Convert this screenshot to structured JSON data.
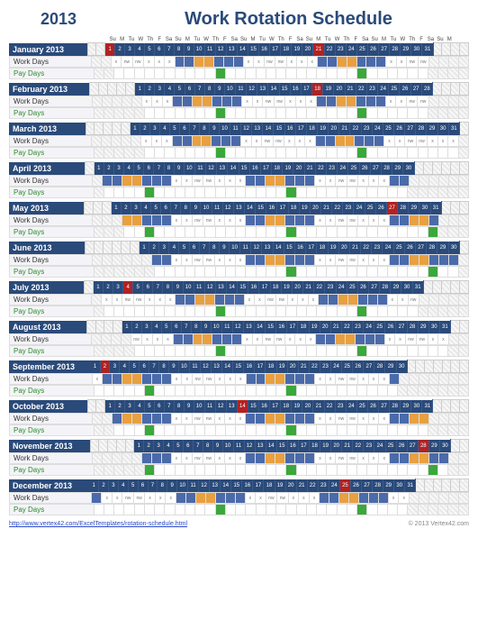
{
  "year": "2013",
  "title": "Work Rotation Schedule",
  "dayHeaders": [
    "Su",
    "M",
    "Tu",
    "W",
    "Th",
    "F",
    "Sa",
    "Su",
    "M",
    "Tu",
    "W",
    "Th",
    "F",
    "Sa",
    "Su",
    "M",
    "Tu",
    "W",
    "Th",
    "F",
    "Sa",
    "Su",
    "M",
    "Tu",
    "W",
    "Th",
    "F",
    "Sa",
    "Su",
    "M",
    "Tu",
    "W",
    "Th",
    "F",
    "Sa",
    "Su",
    "M"
  ],
  "rowLabels": {
    "work": "Work Days",
    "pay": "Pay Days"
  },
  "months": [
    {
      "name": "January 2013",
      "offset": 2,
      "days": 31,
      "holidays": [
        1,
        21
      ]
    },
    {
      "name": "February 2013",
      "offset": 5,
      "days": 28,
      "holidays": [
        18
      ]
    },
    {
      "name": "March 2013",
      "offset": 5,
      "days": 31,
      "holidays": []
    },
    {
      "name": "April 2013",
      "offset": 1,
      "days": 30,
      "holidays": []
    },
    {
      "name": "May 2013",
      "offset": 3,
      "days": 31,
      "holidays": [
        27
      ]
    },
    {
      "name": "June 2013",
      "offset": 6,
      "days": 30,
      "holidays": []
    },
    {
      "name": "July 2013",
      "offset": 1,
      "days": 31,
      "holidays": [
        4
      ]
    },
    {
      "name": "August 2013",
      "offset": 4,
      "days": 31,
      "holidays": []
    },
    {
      "name": "September 2013",
      "offset": 0,
      "days": 30,
      "holidays": [
        2
      ]
    },
    {
      "name": "October 2013",
      "offset": 2,
      "days": 31,
      "holidays": [
        14
      ]
    },
    {
      "name": "November 2013",
      "offset": 5,
      "days": 30,
      "holidays": [
        28
      ]
    },
    {
      "name": "December 2013",
      "offset": 0,
      "days": 31,
      "holidays": [
        25
      ]
    }
  ],
  "pattern": {
    "anchor_monday": {
      "month": 0,
      "day": 7
    },
    "blue_dows": [
      1,
      2,
      5,
      6,
      0
    ],
    "orange_dows": [
      3,
      4
    ],
    "off_label": "x",
    "nw_label": "nw"
  },
  "footer": {
    "link_text": "http://www.vertex42.com/ExcelTemplates/rotation-schedule.html",
    "link_href": "#",
    "copyright": "© 2013 Vertex42.com"
  }
}
